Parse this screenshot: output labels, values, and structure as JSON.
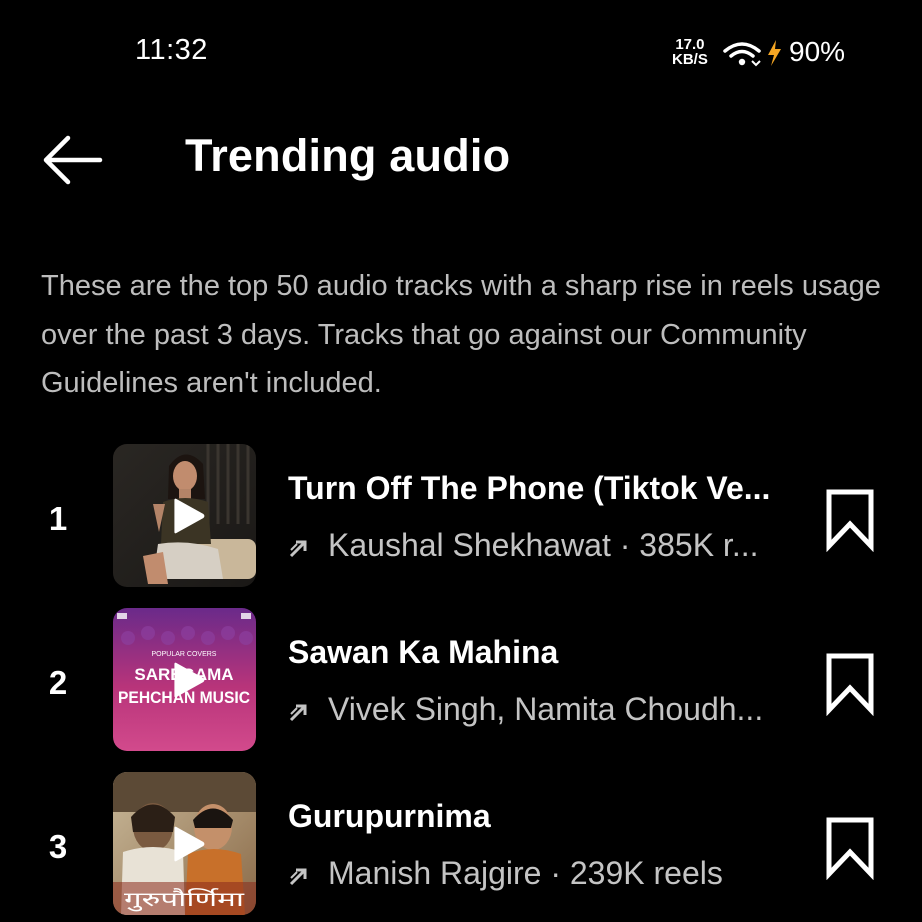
{
  "status_bar": {
    "time": "11:32",
    "net_speed_value": "17.0",
    "net_speed_unit": "KB/S",
    "battery_percent": "90%"
  },
  "header": {
    "title": "Trending audio"
  },
  "description": "These are the top 50 audio tracks with a sharp rise in reels usage over the past 3 days. Tracks that go against our Community Guidelines aren't included.",
  "tracks": [
    {
      "rank": "1",
      "title": "Turn Off The Phone (Tiktok Ve...",
      "subtitle": "Kaushal Shekhawat · 385K r..."
    },
    {
      "rank": "2",
      "title": "Sawan Ka Mahina",
      "subtitle": "Vivek Singh,  Namita Choudh...",
      "cover_text": {
        "top": "POPULAR COVERS",
        "line1": "SAREGAMA",
        "line2": "PEHCHAN MUSIC"
      }
    },
    {
      "rank": "3",
      "title": "Gurupurnima",
      "subtitle": "Manish Rajgire · 239K reels",
      "cover_text": {
        "line1": "गुरुपौर्णिमा"
      }
    }
  ],
  "colors": {
    "background": "#000000",
    "text_primary": "#ffffff",
    "text_secondary": "#bdbdbd",
    "bolt": "#f5a623"
  },
  "icons": {
    "back": "arrow-left-icon",
    "trend": "trending-up-icon",
    "save": "bookmark-outline-icon",
    "play": "play-icon"
  }
}
